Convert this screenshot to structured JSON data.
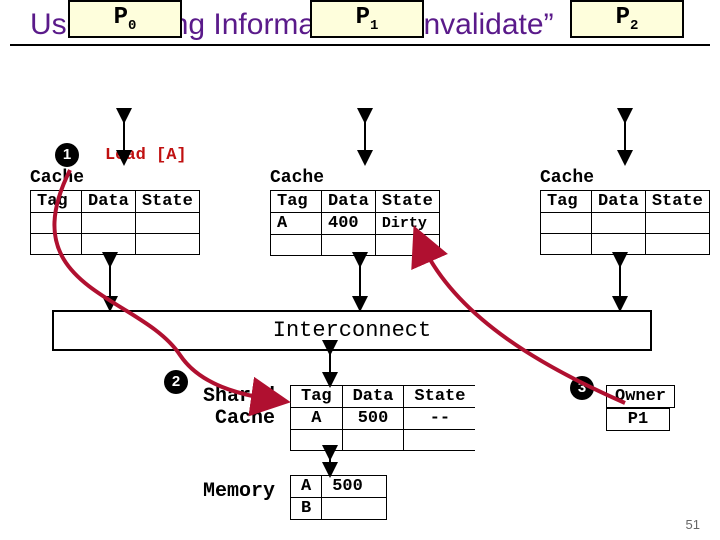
{
  "title": "Use Tracking Information to “Invalidate”",
  "processors": {
    "p0": "P",
    "p0sub": "0",
    "p1": "P",
    "p1sub": "1",
    "p2": "P",
    "p2sub": "2"
  },
  "steps": {
    "s1": "1",
    "s2": "2",
    "s3": "3"
  },
  "op": "Load [A]",
  "cache_label": "Cache",
  "cache_headers": {
    "tag": "Tag",
    "data": "Data",
    "state": "State"
  },
  "p1_row": {
    "tag": "A",
    "data": "400",
    "state": "Dirty"
  },
  "interconnect": "Interconnect",
  "shared_label_l1": "Shared",
  "shared_label_l2": "Cache",
  "shared_headers": {
    "tag": "Tag",
    "data": "Data",
    "state": "State",
    "owner": "Owner"
  },
  "shared_row": {
    "tag": "A",
    "data": "500",
    "state": "--",
    "owner": "P1"
  },
  "memory_label": "Memory",
  "memory_rows": [
    {
      "tag": "A",
      "data": "500"
    },
    {
      "tag": "B",
      "data": ""
    }
  ],
  "slide": "51"
}
